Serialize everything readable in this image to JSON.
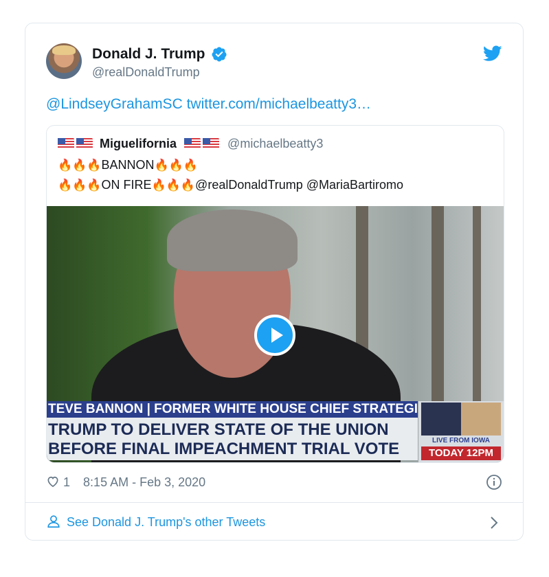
{
  "author": {
    "display_name": "Donald J. Trump",
    "handle": "@realDonaldTrump",
    "verified": true
  },
  "tweet_text": "@LindseyGrahamSC twitter.com/michaelbeatty3…",
  "quoted": {
    "display_name": "Miguelifornia",
    "handle": "@michaelbeatty3",
    "line1_text": "BANNON",
    "line2_text": "ON FIRE",
    "line2_mentions": "@realDonaldTrump @MariaBartiromo",
    "fire_glyph": "🔥"
  },
  "video": {
    "nameplate": "TEVE BANNON | FORMER WHITE HOUSE CHIEF STRATEGIST",
    "headline_1": "TRUMP TO DELIVER STATE OF THE UNION",
    "headline_2": "BEFORE FINAL IMPEACHMENT TRIAL VOTE",
    "side_live": "LIVE FROM IOWA",
    "side_time": "TODAY 12PM"
  },
  "meta": {
    "likes": "1",
    "timestamp": "8:15 AM - Feb 3, 2020"
  },
  "footer": {
    "see_more": "See Donald J. Trump's other Tweets"
  },
  "colors": {
    "link": "#1b95e0",
    "twitter_blue": "#1da1f2",
    "muted": "#657786"
  },
  "icons": [
    "twitter-bird-icon",
    "verified-badge-icon",
    "play-icon",
    "heart-icon",
    "info-icon",
    "person-icon",
    "chevron-right-icon"
  ]
}
